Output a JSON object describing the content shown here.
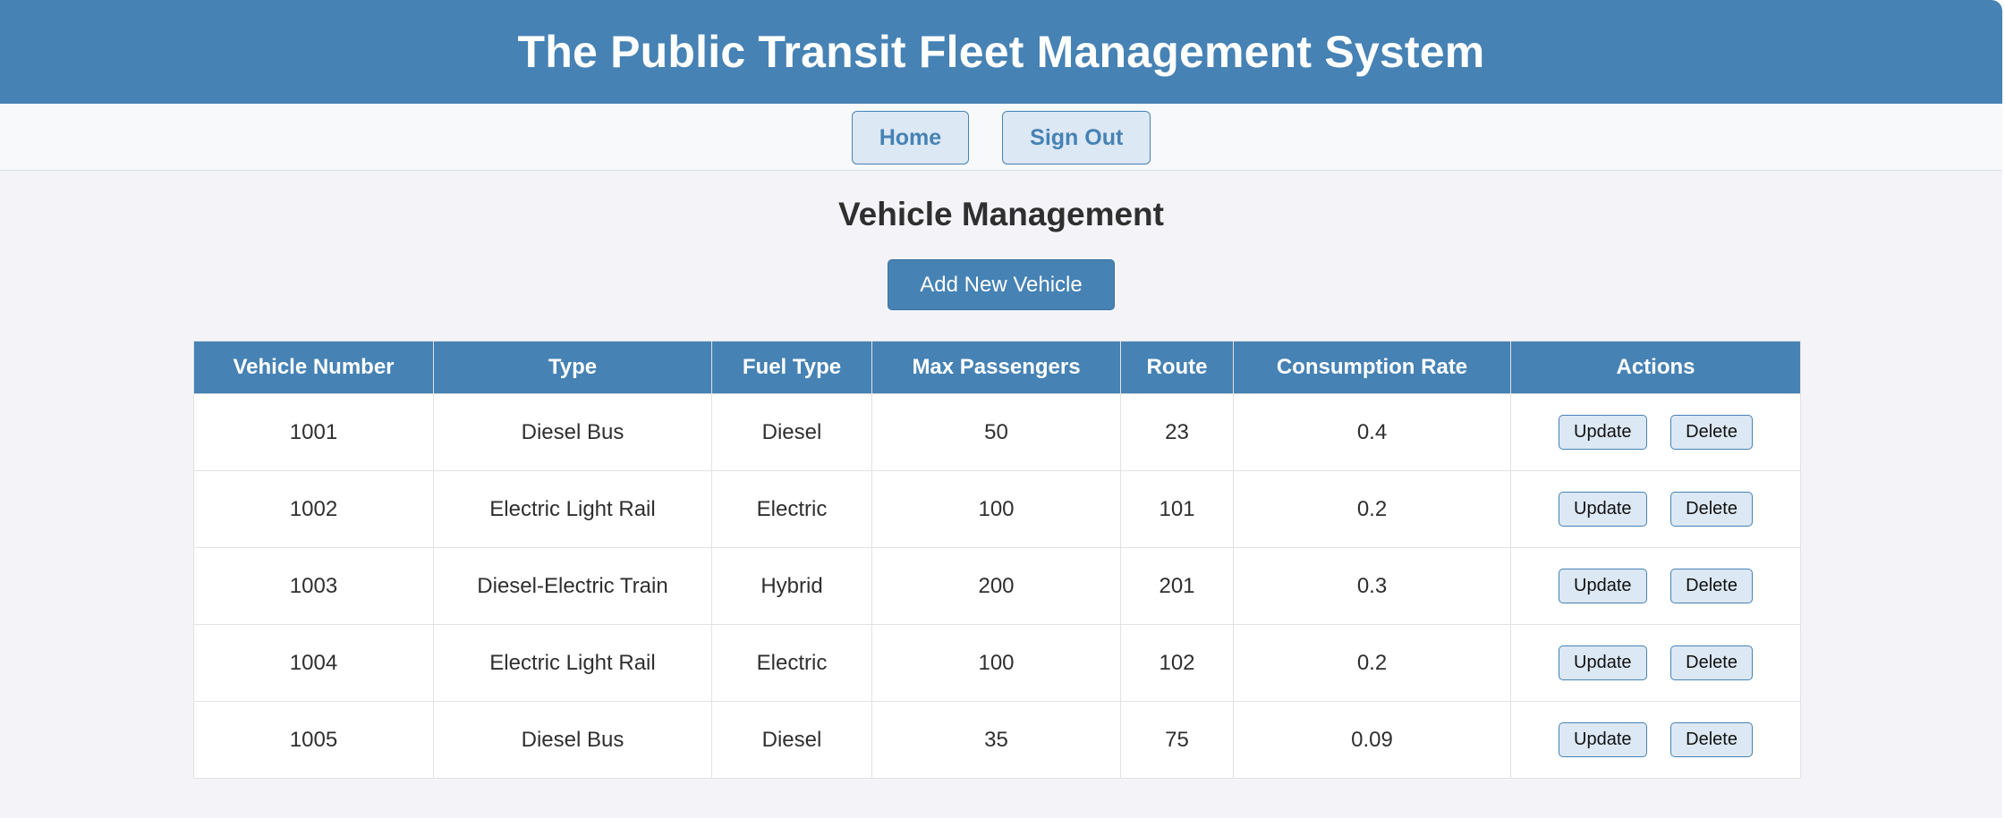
{
  "header": {
    "title": "The Public Transit Fleet Management System"
  },
  "nav": {
    "home_label": "Home",
    "signout_label": "Sign Out"
  },
  "main": {
    "title": "Vehicle Management",
    "add_button_label": "Add New Vehicle"
  },
  "table": {
    "columns": [
      "Vehicle Number",
      "Type",
      "Fuel Type",
      "Max Passengers",
      "Route",
      "Consumption Rate",
      "Actions"
    ],
    "rows": [
      {
        "vehicle_number": "1001",
        "type": "Diesel Bus",
        "fuel_type": "Diesel",
        "max_passengers": "50",
        "route": "23",
        "consumption_rate": "0.4"
      },
      {
        "vehicle_number": "1002",
        "type": "Electric Light Rail",
        "fuel_type": "Electric",
        "max_passengers": "100",
        "route": "101",
        "consumption_rate": "0.2"
      },
      {
        "vehicle_number": "1003",
        "type": "Diesel-Electric Train",
        "fuel_type": "Hybrid",
        "max_passengers": "200",
        "route": "201",
        "consumption_rate": "0.3"
      },
      {
        "vehicle_number": "1004",
        "type": "Electric Light Rail",
        "fuel_type": "Electric",
        "max_passengers": "100",
        "route": "102",
        "consumption_rate": "0.2"
      },
      {
        "vehicle_number": "1005",
        "type": "Diesel Bus",
        "fuel_type": "Diesel",
        "max_passengers": "35",
        "route": "75",
        "consumption_rate": "0.09"
      }
    ],
    "update_label": "Update",
    "delete_label": "Delete"
  },
  "colors": {
    "primary": "#4682b4",
    "button_bg": "#dce8f4",
    "page_bg": "#f4f4f8"
  }
}
